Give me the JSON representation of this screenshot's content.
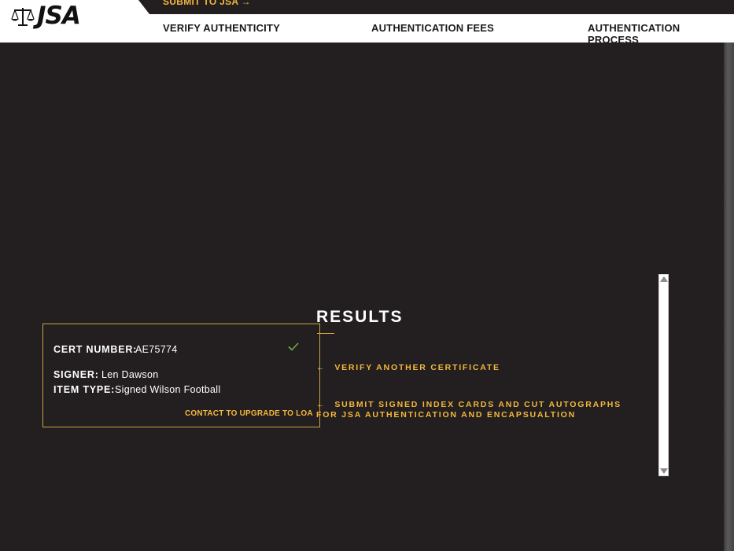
{
  "header": {
    "logo_text": "JSA",
    "submit_link": "SUBMIT TO JSA →",
    "nav": [
      "VERIFY AUTHENTICITY",
      "AUTHENTICATION FEES",
      "AUTHENTICATION PROCESS"
    ]
  },
  "results": {
    "title": "RESULTS",
    "cert_label": "CERT NUMBER:",
    "cert_value": "AE75774",
    "signer_label": "SIGNER:",
    "signer_value": "Len Dawson",
    "item_type_label": "ITEM TYPE:",
    "item_type_value": "Signed Wilson Football",
    "upgrade_link": "CONTACT TO UPGRADE TO LOA",
    "verify_icon": "check-icon",
    "verify_color": "#6ab04c"
  },
  "actions": {
    "arrow": "←",
    "verify_another": "VERIFY ANOTHER CERTIFICATE",
    "submit_cards": "SUBMIT SIGNED INDEX CARDS AND CUT AUTOGRAPHS FOR JSA AUTHENTICATION AND ENCAPSUALTION"
  },
  "colors": {
    "background": "#231f20",
    "accent": "#f4b83c",
    "header": "#ffffff"
  }
}
